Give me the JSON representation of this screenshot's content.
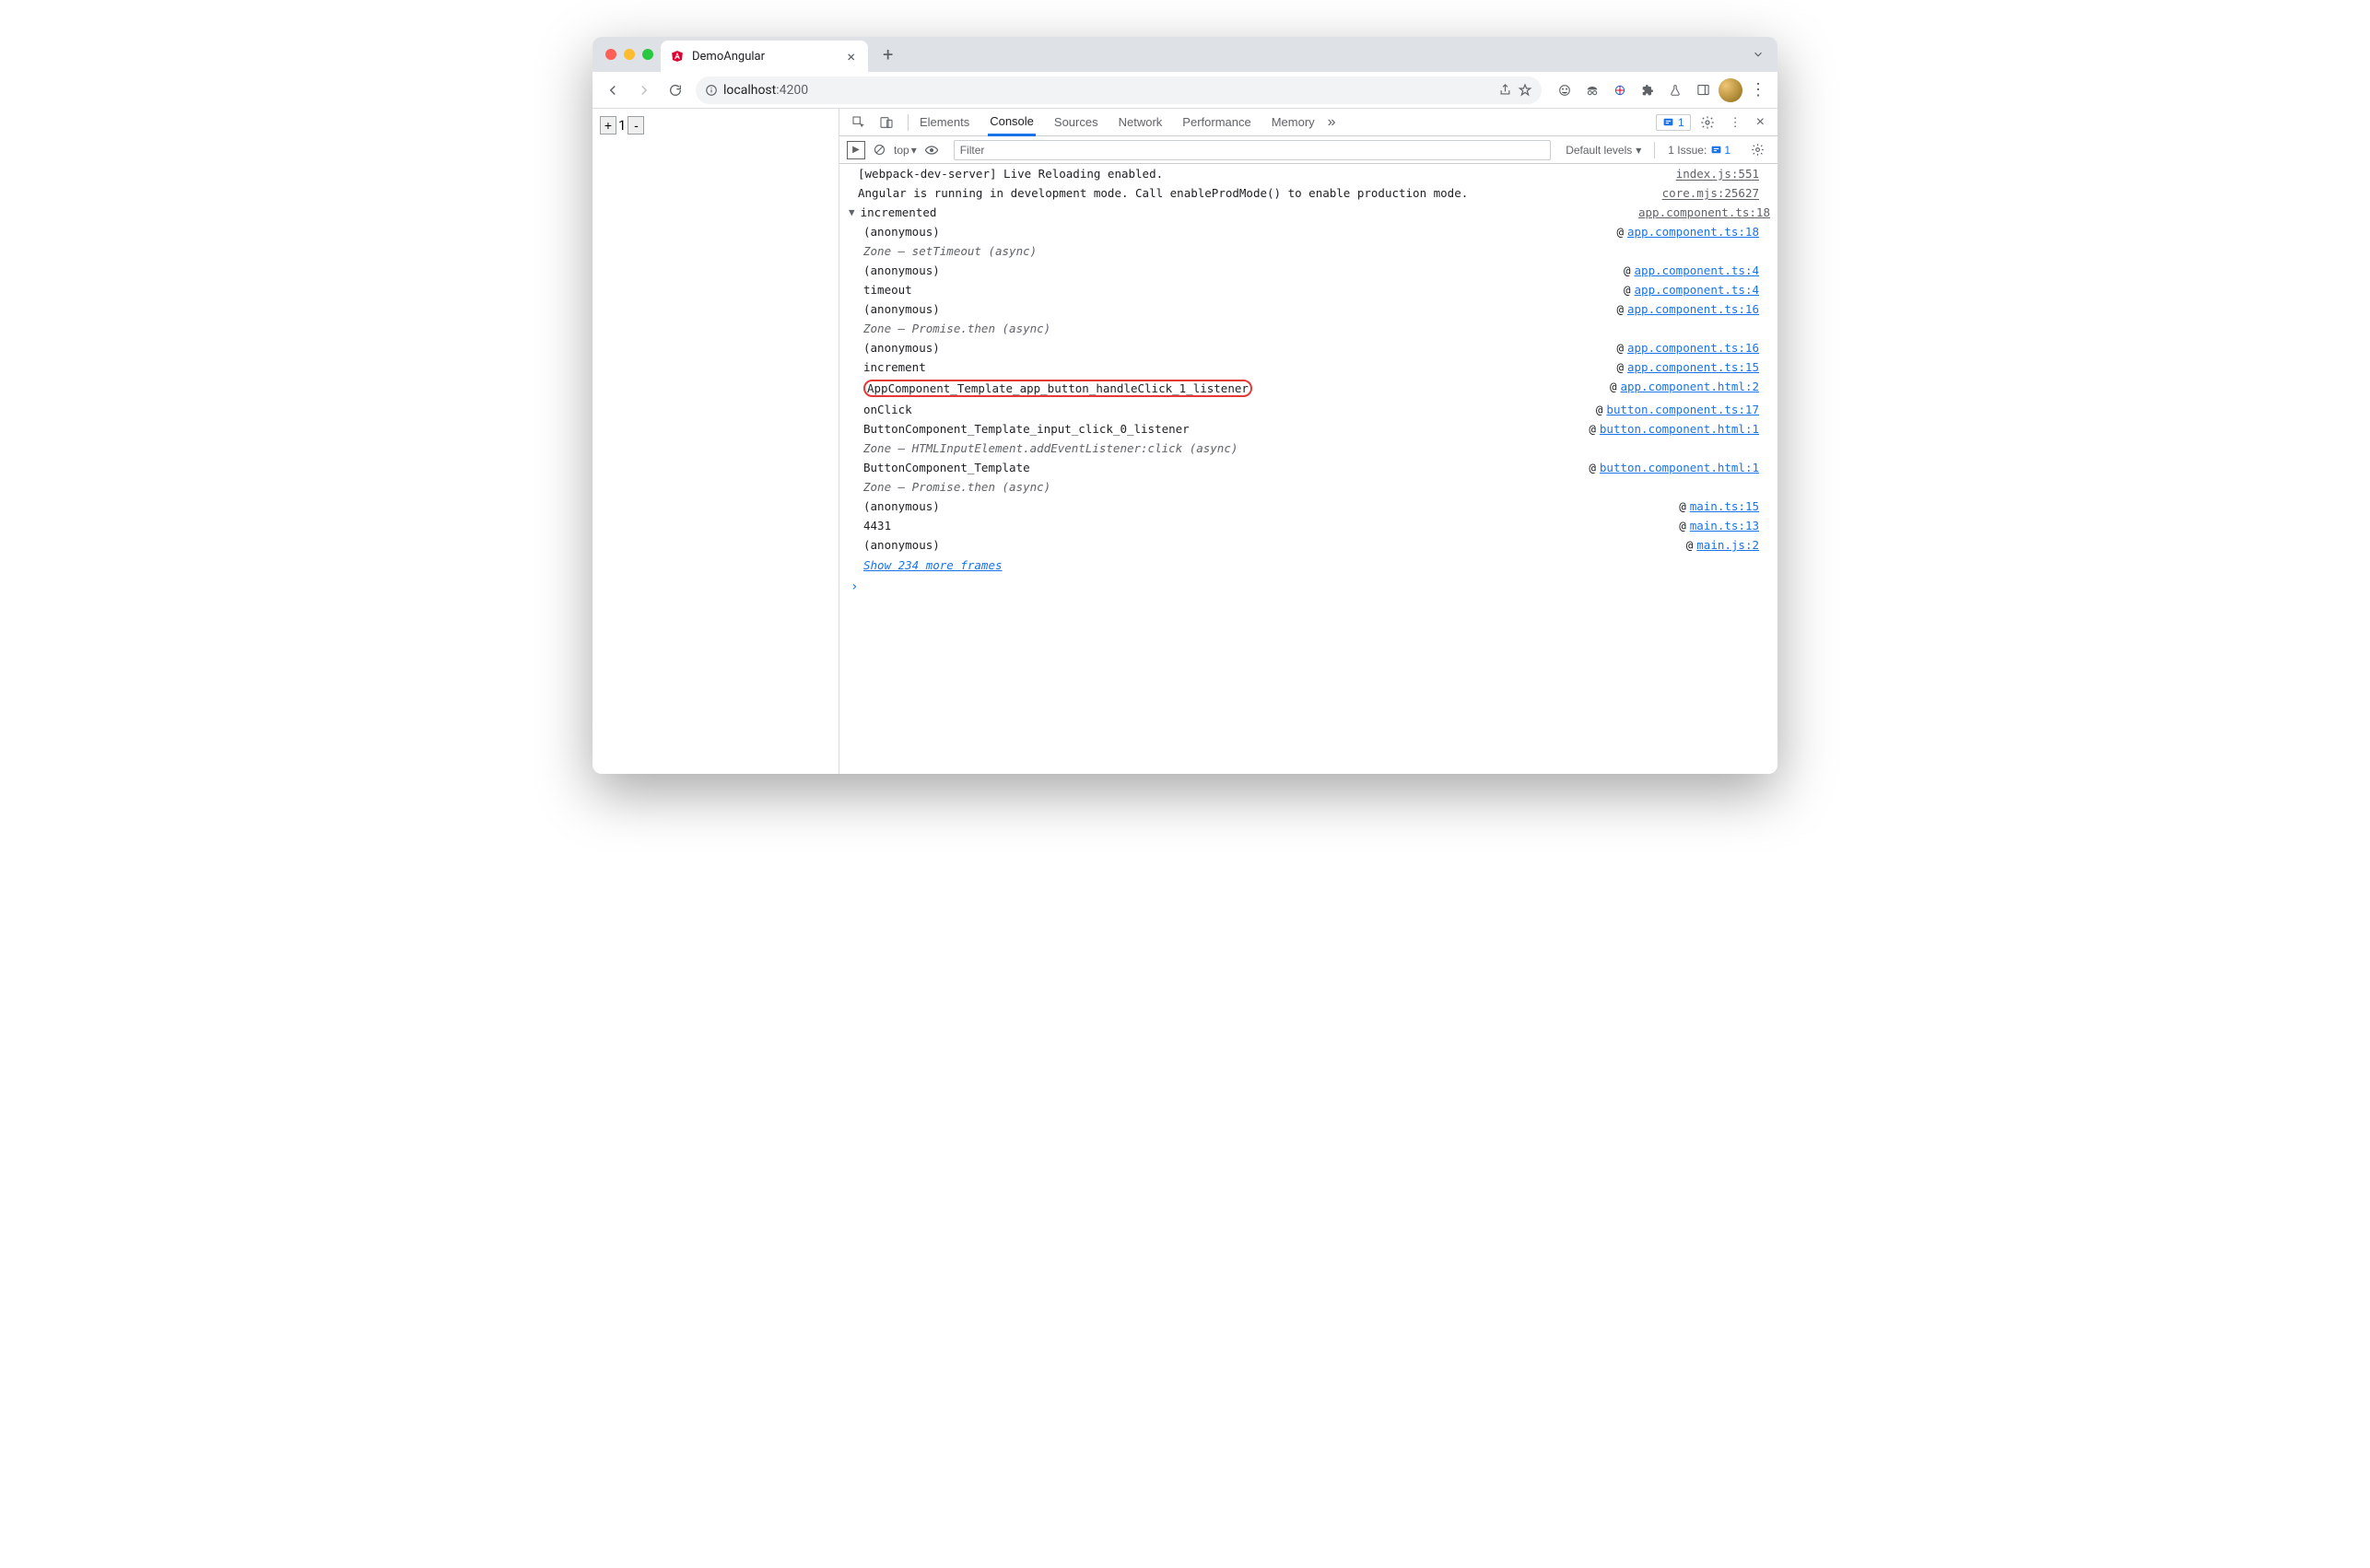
{
  "browser": {
    "tab_title": "DemoAngular",
    "url_host": "localhost",
    "url_path": ":4200"
  },
  "page": {
    "plus": "+",
    "counter_value": "1",
    "minus": "-"
  },
  "devtools": {
    "tabs": [
      "Elements",
      "Console",
      "Sources",
      "Network",
      "Performance",
      "Memory"
    ],
    "active_tab": "Console",
    "badge_count": "1",
    "subbar": {
      "context": "top",
      "filter_placeholder": "Filter",
      "levels_label": "Default levels",
      "issues_prefix": "1 Issue:",
      "issues_count": "1"
    },
    "logs": [
      {
        "msg": "[webpack-dev-server] Live Reloading enabled.",
        "src": "index.js:551"
      },
      {
        "msg": "Angular is running in development mode. Call enableProdMode() to enable production mode.",
        "src": "core.mjs:25627"
      }
    ],
    "trace": {
      "label": "incremented",
      "src": "app.component.ts:18",
      "frames": [
        {
          "name": "(anonymous)",
          "loc": "app.component.ts:18"
        },
        {
          "name": "Zone — setTimeout (async)",
          "italic": true
        },
        {
          "name": "(anonymous)",
          "loc": "app.component.ts:4"
        },
        {
          "name": "timeout",
          "loc": "app.component.ts:4"
        },
        {
          "name": "(anonymous)",
          "loc": "app.component.ts:16"
        },
        {
          "name": "Zone — Promise.then (async)",
          "italic": true
        },
        {
          "name": "(anonymous)",
          "loc": "app.component.ts:16"
        },
        {
          "name": "increment",
          "loc": "app.component.ts:15"
        },
        {
          "name": "AppComponent_Template_app_button_handleClick_1_listener",
          "loc": "app.component.html:2",
          "highlight": true
        },
        {
          "name": "onClick",
          "loc": "button.component.ts:17"
        },
        {
          "name": "ButtonComponent_Template_input_click_0_listener",
          "loc": "button.component.html:1"
        },
        {
          "name": "Zone — HTMLInputElement.addEventListener:click (async)",
          "italic": true
        },
        {
          "name": "ButtonComponent_Template",
          "loc": "button.component.html:1"
        },
        {
          "name": "Zone — Promise.then (async)",
          "italic": true
        },
        {
          "name": "(anonymous)",
          "loc": "main.ts:15"
        },
        {
          "name": "4431",
          "loc": "main.ts:13"
        },
        {
          "name": "(anonymous)",
          "loc": "main.js:2"
        }
      ],
      "show_more": "Show 234 more frames"
    }
  }
}
